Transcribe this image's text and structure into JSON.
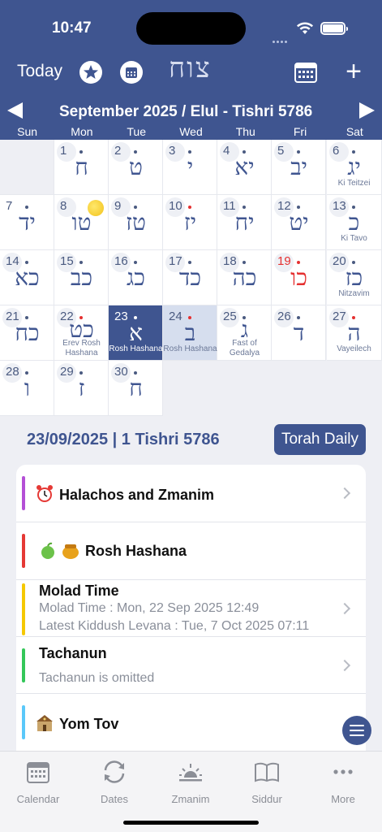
{
  "status_bar": {
    "time": "10:47"
  },
  "toolbar": {
    "today_label": "Today",
    "logo_text": "צוח"
  },
  "calendar": {
    "title": "September 2025 / Elul - Tishri 5786",
    "weekdays": [
      "Sun",
      "Mon",
      "Tue",
      "Wed",
      "Thu",
      "Fri",
      "Sat"
    ],
    "days": [
      {
        "num": "1",
        "heb": "ח",
        "label": ""
      },
      {
        "num": "2",
        "heb": "ט",
        "label": ""
      },
      {
        "num": "3",
        "heb": "י",
        "label": ""
      },
      {
        "num": "4",
        "heb": "יא",
        "label": ""
      },
      {
        "num": "5",
        "heb": "יב",
        "label": ""
      },
      {
        "num": "6",
        "heb": "יג",
        "label": "Ki Teitzei"
      },
      {
        "num": "7",
        "heb": "יד",
        "label": ""
      },
      {
        "num": "8",
        "heb": "טו",
        "label": ""
      },
      {
        "num": "9",
        "heb": "טז",
        "label": ""
      },
      {
        "num": "10",
        "heb": "יז",
        "label": ""
      },
      {
        "num": "11",
        "heb": "יח",
        "label": ""
      },
      {
        "num": "12",
        "heb": "יט",
        "label": ""
      },
      {
        "num": "13",
        "heb": "כ",
        "label": "Ki Tavo"
      },
      {
        "num": "14",
        "heb": "כא",
        "label": ""
      },
      {
        "num": "15",
        "heb": "כב",
        "label": ""
      },
      {
        "num": "16",
        "heb": "כג",
        "label": ""
      },
      {
        "num": "17",
        "heb": "כד",
        "label": ""
      },
      {
        "num": "18",
        "heb": "כה",
        "label": ""
      },
      {
        "num": "19",
        "heb": "כו",
        "label": ""
      },
      {
        "num": "20",
        "heb": "כז",
        "label": "Nitzavim"
      },
      {
        "num": "21",
        "heb": "כח",
        "label": ""
      },
      {
        "num": "22",
        "heb": "כט",
        "label": "Erev Rosh Hashana"
      },
      {
        "num": "23",
        "heb": "א",
        "label": "Rosh Hashana"
      },
      {
        "num": "24",
        "heb": "ב",
        "label": "Rosh Hashana"
      },
      {
        "num": "25",
        "heb": "ג",
        "label": "Fast of Gedalya"
      },
      {
        "num": "26",
        "heb": "ד",
        "label": ""
      },
      {
        "num": "27",
        "heb": "ה",
        "label": "Vayeilech"
      },
      {
        "num": "28",
        "heb": "ו",
        "label": ""
      },
      {
        "num": "29",
        "heb": "ז",
        "label": ""
      },
      {
        "num": "30",
        "heb": "ח",
        "label": ""
      }
    ]
  },
  "info": {
    "date_text": "23/09/2025 | 1 Tishri 5786",
    "torah_daily_label": "Torah Daily"
  },
  "list": {
    "halachos": {
      "title": "Halachos and Zmanim",
      "color": "#b44fd6"
    },
    "rosh_hashana": {
      "title": "Rosh Hashana",
      "color": "#e53935"
    },
    "molad": {
      "title": "Molad Time",
      "line1": "Molad Time : Mon, 22 Sep 2025 12:49",
      "line2": "Latest Kiddush Levana : Tue, 7 Oct 2025 07:11",
      "color": "#f5c800"
    },
    "tachanun": {
      "title": "Tachanun",
      "line1": "Tachanun is omitted",
      "color": "#34c759"
    },
    "yom_tov": {
      "title": "Yom Tov",
      "color": "#5ac8fa"
    }
  },
  "tabs": [
    "Calendar",
    "Dates",
    "Zmanim",
    "Siddur",
    "More"
  ]
}
